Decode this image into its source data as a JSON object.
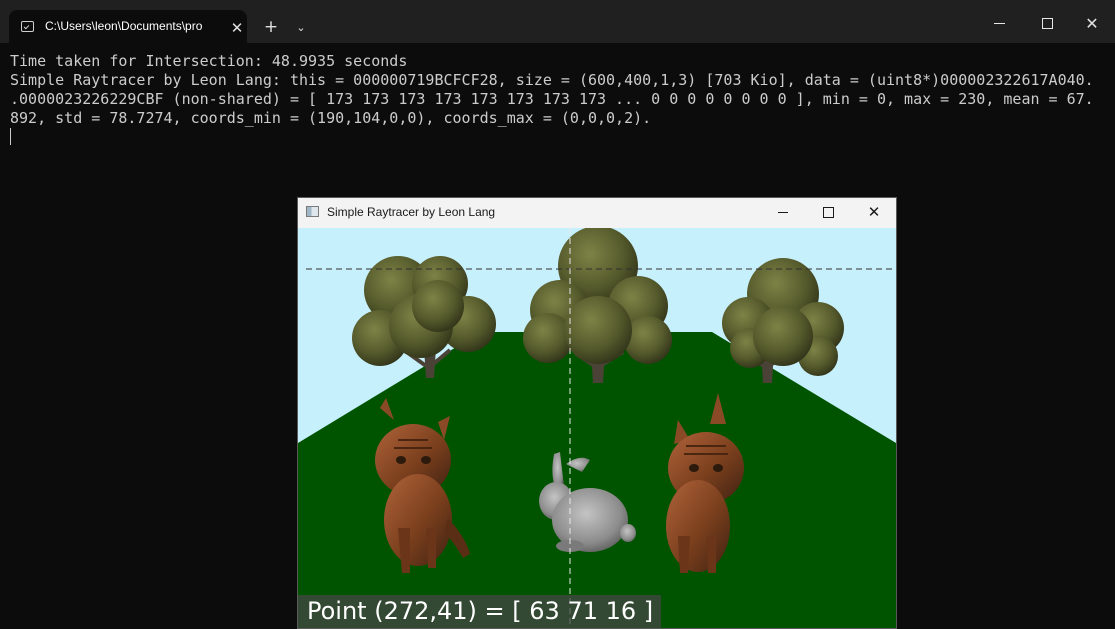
{
  "terminal": {
    "tab_title": "C:\\Users\\leon\\Documents\\pro",
    "tab_close_icon": "close-icon",
    "new_tab_symbol": "+",
    "dropdown_symbol": "⌄",
    "close_symbol": "✕",
    "lines": [
      "Time taken for Intersection: 48.9935 seconds",
      "Simple Raytracer by Leon Lang: this = 000000719BCFCF28, size = (600,400,1,3) [703 Kio], data = (uint8*)000002322617A040.",
      ".0000023226229CBF (non-shared) = [ 173 173 173 173 173 173 173 173 ... 0 0 0 0 0 0 0 0 ], min = 0, max = 230, mean = 67.",
      "892, std = 78.7274, coords_min = (190,104,0,0), coords_max = (0,0,0,2)."
    ]
  },
  "viewer": {
    "title": "Simple Raytracer by Leon Lang",
    "close_symbol": "✕",
    "status": "Point (272,41) = [ 63 71 16 ]",
    "colors": {
      "sky": "#c7f0fd",
      "ground": "#005400",
      "tree_foliage": "#5b6030",
      "tree_trunk": "#4b4237",
      "cat": "#8a4a25",
      "bunny": "#9a9a9a"
    }
  }
}
